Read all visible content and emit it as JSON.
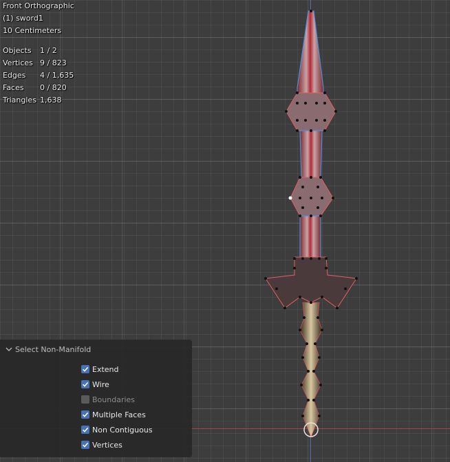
{
  "viewport": {
    "view_name": "Front Orthographic",
    "object_name": "(1) sword1",
    "scale": "10 Centimeters"
  },
  "stats": [
    {
      "label": "Objects",
      "value": "1 / 2"
    },
    {
      "label": "Vertices",
      "value": "9 / 823"
    },
    {
      "label": "Edges",
      "value": "4 / 1,635"
    },
    {
      "label": "Faces",
      "value": "0 / 820"
    },
    {
      "label": "Triangles",
      "value": "1,638"
    }
  ],
  "panel": {
    "title": "Select Non-Manifold",
    "options": [
      {
        "label": "Extend",
        "checked": true,
        "enabled": true
      },
      {
        "label": "Wire",
        "checked": true,
        "enabled": true
      },
      {
        "label": "Boundaries",
        "checked": false,
        "enabled": false
      },
      {
        "label": "Multiple Faces",
        "checked": true,
        "enabled": true
      },
      {
        "label": "Non Contiguous",
        "checked": true,
        "enabled": true
      },
      {
        "label": "Vertices",
        "checked": true,
        "enabled": true
      }
    ]
  },
  "colors": {
    "checkbox_on": "#4772b3",
    "x_axis": "#a8434b",
    "z_axis": "#3f6fa8",
    "selection_edge": "#4a90e0",
    "vertex": "#111111"
  }
}
